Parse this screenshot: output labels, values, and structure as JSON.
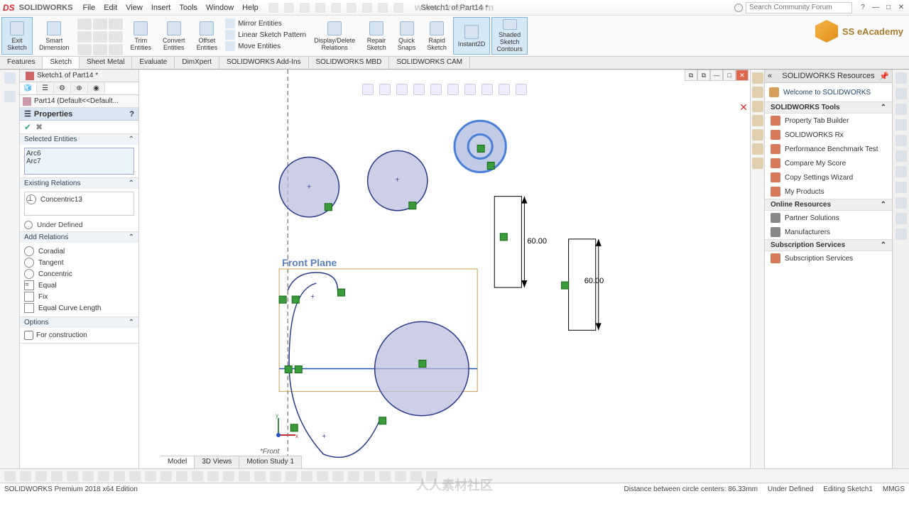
{
  "app": {
    "logo": "DS",
    "name": "SOLIDWORKS"
  },
  "menu": [
    "File",
    "Edit",
    "View",
    "Insert",
    "Tools",
    "Window",
    "Help"
  ],
  "doc_title": "Sketch1 of Part14 *",
  "search_placeholder": "Search Community Forum",
  "ribbon": {
    "exit_sketch": "Exit\nSketch",
    "smart_dim": "Smart\nDimension",
    "trim": "Trim\nEntities",
    "convert": "Convert\nEntities",
    "offset": "Offset\nEntities",
    "mirror": "Mirror Entities",
    "linear": "Linear Sketch Pattern",
    "move": "Move Entities",
    "display_del": "Display/Delete\nRelations",
    "repair": "Repair\nSketch",
    "quick_snaps": "Quick\nSnaps",
    "rapid": "Rapid\nSketch",
    "instant2d": "Instant2D",
    "shaded": "Shaded\nSketch\nContours",
    "academy": "SS eAcademy"
  },
  "ribbon_tabs": [
    "Features",
    "Sketch",
    "Sheet Metal",
    "Evaluate",
    "DimXpert",
    "SOLIDWORKS Add-Ins",
    "SOLIDWORKS MBD",
    "SOLIDWORKS CAM"
  ],
  "ribbon_tab_active": 1,
  "doc_tab": "Sketch1 of Part14 *",
  "breadcrumb": "Part14 (Default<<Default...",
  "panel": {
    "title": "Properties",
    "sect_selected": "Selected Entities",
    "selected_items": [
      "Arc6",
      "Arc7"
    ],
    "sect_existing": "Existing Relations",
    "existing_items": [
      "Concentric13"
    ],
    "status": "Under Defined",
    "sect_add": "Add Relations",
    "relations": [
      "Coradial",
      "Tangent",
      "Concentric",
      "Equal",
      "Fix",
      "Equal Curve Length"
    ],
    "sect_options": "Options",
    "opt_construction": "For construction"
  },
  "sketch": {
    "plane_label": "Front Plane",
    "dim1": "60.00",
    "dim2": "60.00",
    "view_name": "*Front"
  },
  "bottom_tabs": [
    "Model",
    "3D Views",
    "Motion Study 1"
  ],
  "bottom_tab_active": 0,
  "resources": {
    "title": "SOLIDWORKS Resources",
    "welcome": "Welcome to SOLIDWORKS",
    "sect_tools": "SOLIDWORKS Tools",
    "tools": [
      "Property Tab Builder",
      "SOLIDWORKS Rx",
      "Performance Benchmark Test",
      "Compare My Score",
      "Copy Settings Wizard",
      "My Products"
    ],
    "sect_online": "Online Resources",
    "online": [
      "Partner Solutions",
      "Manufacturers"
    ],
    "sect_sub": "Subscription Services",
    "sub": [
      "Subscription Services"
    ]
  },
  "status": {
    "left": "SOLIDWORKS Premium 2018 x64 Edition",
    "dist": "Distance between circle centers: 86.33mm",
    "ud": "Under Defined",
    "edit": "Editing Sketch1",
    "units": "MMGS"
  },
  "watermark_top": "www.rr-sc.com",
  "watermark_bottom": "人人素材社区"
}
